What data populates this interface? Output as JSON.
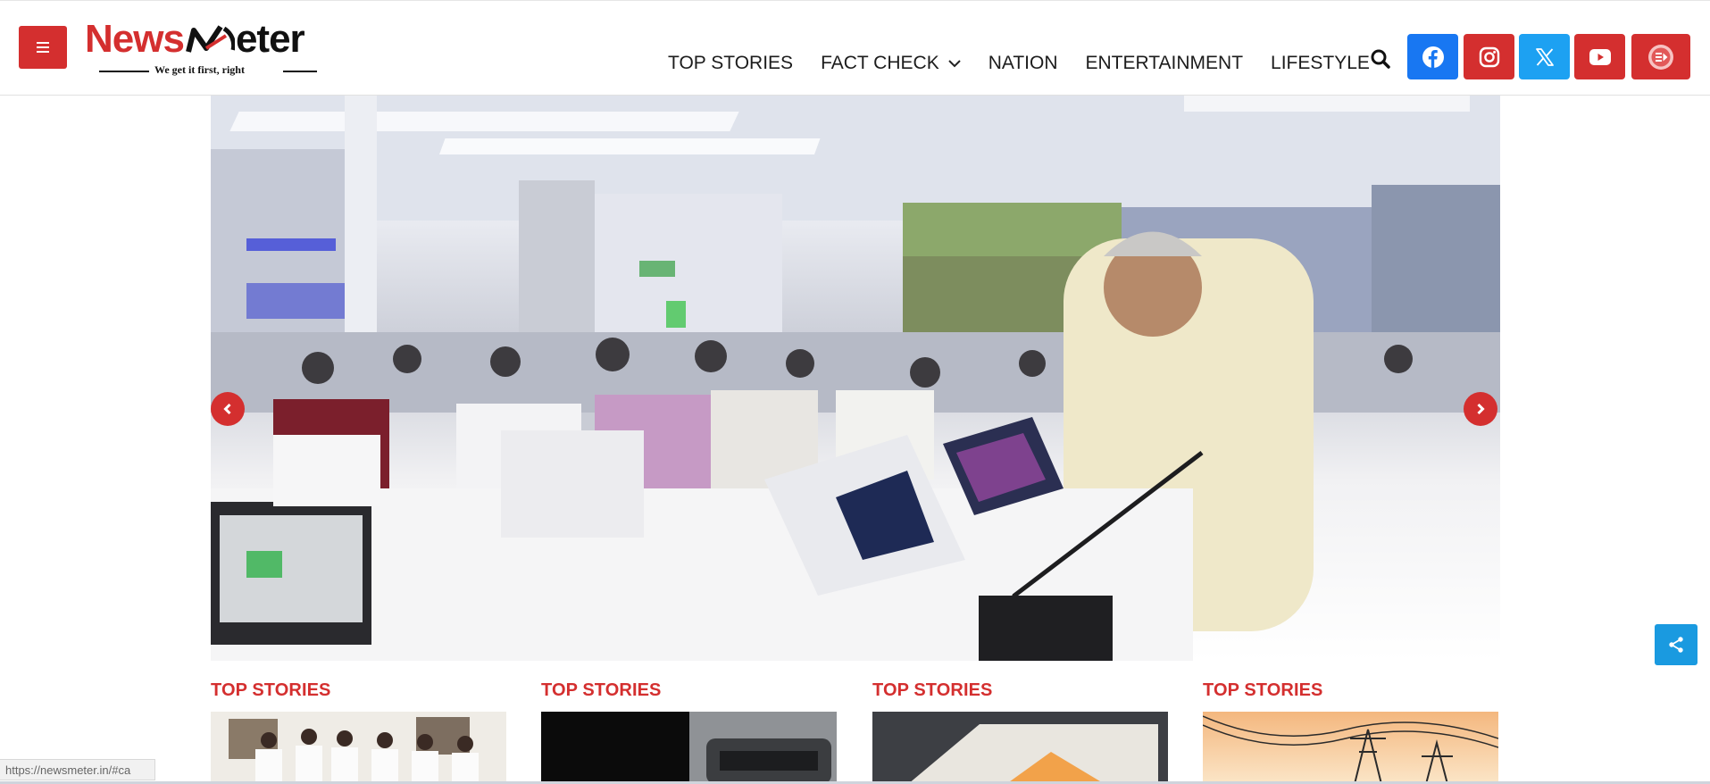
{
  "header": {
    "menu_icon": "hamburger-icon",
    "logo": {
      "brand_left": "News",
      "brand_right": "eter",
      "tagline": "We get it first, right"
    },
    "nav": [
      {
        "label": "TOP STORIES"
      },
      {
        "label": "FACT CHECK",
        "has_dropdown": true
      },
      {
        "label": "NATION"
      },
      {
        "label": "ENTERTAINMENT"
      },
      {
        "label": "LIFESTYLE"
      }
    ],
    "search_icon": "search-icon",
    "social": [
      {
        "name": "facebook-icon",
        "color": "#1877f2"
      },
      {
        "name": "instagram-icon",
        "color": "#d42f2f"
      },
      {
        "name": "x-icon",
        "color": "#1da1f2"
      },
      {
        "name": "youtube-icon",
        "color": "#d42f2f"
      },
      {
        "name": "video-playlist-icon",
        "color": "#d42f2f"
      }
    ],
    "brand_color": "#d42f2f"
  },
  "hero": {
    "prev_icon": "chevron-left-icon",
    "next_icon": "chevron-right-icon"
  },
  "stories": [
    {
      "category": "TOP STORIES"
    },
    {
      "category": "TOP STORIES"
    },
    {
      "category": "TOP STORIES"
    },
    {
      "category": "TOP STORIES"
    }
  ],
  "share_icon": "share-icon",
  "status_bar": {
    "url": "https://newsmeter.in/#ca"
  }
}
